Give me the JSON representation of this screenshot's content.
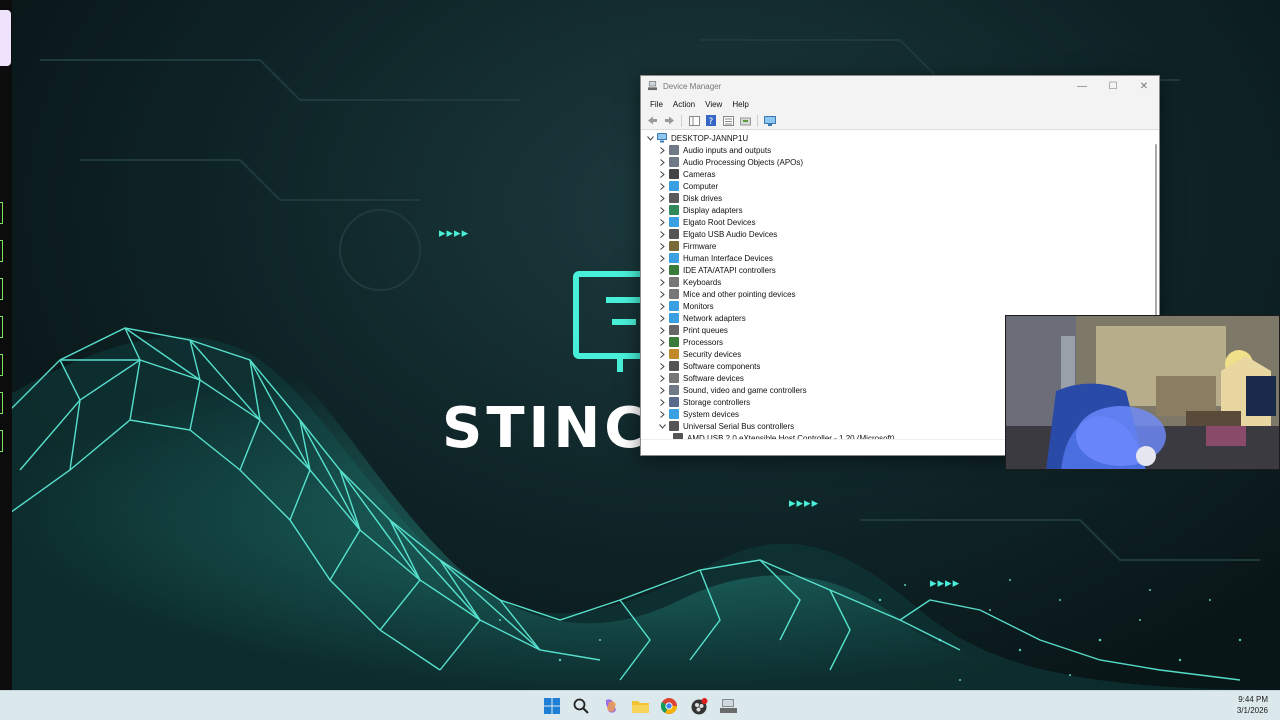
{
  "wallpaper": {
    "brand_text": "STINCI",
    "arrows": "▸▸▸▸",
    "accent_color": "#49f0d9"
  },
  "device_manager": {
    "title": "Device Manager",
    "menu": [
      "File",
      "Action",
      "View",
      "Help"
    ],
    "window_controls": {
      "minimize": "—",
      "maximize": "☐",
      "close": "✕"
    },
    "tree": {
      "root": "DESKTOP-JANNP1U",
      "categories": [
        {
          "label": "Audio inputs and outputs",
          "icon": "speaker-icon",
          "color": "#6f7a86"
        },
        {
          "label": "Audio Processing Objects (APOs)",
          "icon": "speaker-icon",
          "color": "#6f7a86"
        },
        {
          "label": "Cameras",
          "icon": "camera-icon",
          "color": "#444444"
        },
        {
          "label": "Computer",
          "icon": "computer-icon",
          "color": "#3aa0e0"
        },
        {
          "label": "Disk drives",
          "icon": "disk-icon",
          "color": "#5a5a5a"
        },
        {
          "label": "Display adapters",
          "icon": "display-adapter-icon",
          "color": "#2e8b57"
        },
        {
          "label": "Elgato Root Devices",
          "icon": "monitor-icon",
          "color": "#3aa0e0"
        },
        {
          "label": "Elgato USB Audio Devices",
          "icon": "usb-icon",
          "color": "#555555"
        },
        {
          "label": "Firmware",
          "icon": "firmware-icon",
          "color": "#7a6a3a"
        },
        {
          "label": "Human Interface Devices",
          "icon": "hid-icon",
          "color": "#3aa0e0"
        },
        {
          "label": "IDE ATA/ATAPI controllers",
          "icon": "ide-icon",
          "color": "#3a7a3a"
        },
        {
          "label": "Keyboards",
          "icon": "keyboard-icon",
          "color": "#777777"
        },
        {
          "label": "Mice and other pointing devices",
          "icon": "mouse-icon",
          "color": "#777777"
        },
        {
          "label": "Monitors",
          "icon": "monitor-icon",
          "color": "#3aa0e0"
        },
        {
          "label": "Network adapters",
          "icon": "network-icon",
          "color": "#3aa0e0"
        },
        {
          "label": "Print queues",
          "icon": "printer-icon",
          "color": "#666666"
        },
        {
          "label": "Processors",
          "icon": "processor-icon",
          "color": "#3a7a3a"
        },
        {
          "label": "Security devices",
          "icon": "security-icon",
          "color": "#c08a2a"
        },
        {
          "label": "Software components",
          "icon": "software-component-icon",
          "color": "#555555"
        },
        {
          "label": "Software devices",
          "icon": "software-device-icon",
          "color": "#777777"
        },
        {
          "label": "Sound, video and game controllers",
          "icon": "speaker-icon",
          "color": "#6f7a86"
        },
        {
          "label": "Storage controllers",
          "icon": "storage-icon",
          "color": "#5a6a8a"
        },
        {
          "label": "System devices",
          "icon": "system-icon",
          "color": "#3aa0e0"
        },
        {
          "label": "Universal Serial Bus controllers",
          "icon": "usb-icon",
          "color": "#555555",
          "expanded": true
        },
        {
          "label": "AMD USB 2.0 eXtensible Host Controller - 1.20 (Microsoft)",
          "icon": "usb-icon",
          "color": "#555555",
          "child": true
        }
      ]
    }
  },
  "taskbar": {
    "apps": [
      {
        "name": "start-icon",
        "color": "#1f7fd6"
      },
      {
        "name": "search-icon",
        "color": "#222222"
      },
      {
        "name": "copilot-icon",
        "color": "#9a6ee8"
      },
      {
        "name": "file-explorer-icon",
        "color": "#f2c230"
      },
      {
        "name": "chrome-icon",
        "color": "#db4437"
      },
      {
        "name": "obs-icon",
        "color": "#333333"
      },
      {
        "name": "device-manager-icon",
        "color": "#8a8a8a"
      }
    ],
    "clock": {
      "time": "9:44 PM",
      "date": "3/1/2026"
    }
  }
}
